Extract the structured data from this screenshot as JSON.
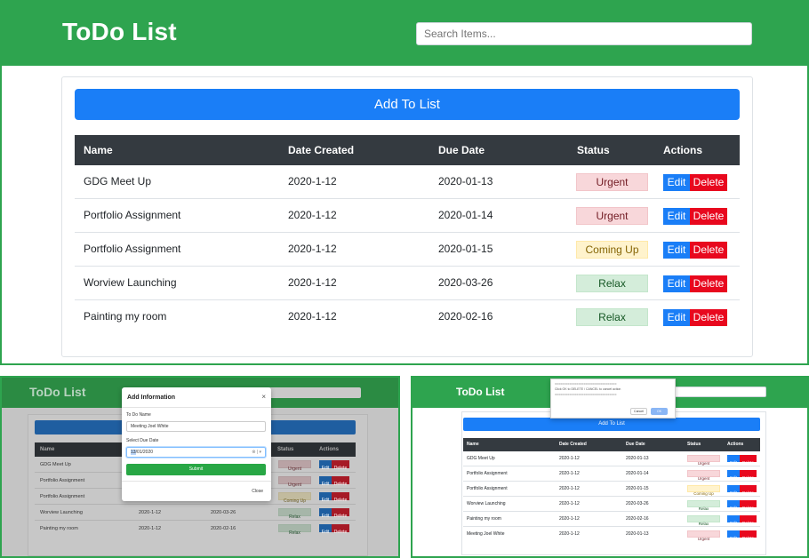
{
  "app": {
    "title": "ToDo List",
    "search_placeholder": "Search Items..."
  },
  "add_button_label": "Add To List",
  "columns": [
    "Name",
    "Date Created",
    "Due Date",
    "Status",
    "Actions"
  ],
  "actions": {
    "edit": "Edit",
    "delete": "Delete"
  },
  "rows": [
    {
      "name": "GDG Meet Up",
      "created": "2020-1-12",
      "due": "2020-01-13",
      "status": "Urgent"
    },
    {
      "name": "Portfolio Assignment",
      "created": "2020-1-12",
      "due": "2020-01-14",
      "status": "Urgent"
    },
    {
      "name": "Portfolio Assignment",
      "created": "2020-1-12",
      "due": "2020-01-15",
      "status": "Coming Up"
    },
    {
      "name": "Worview Launching",
      "created": "2020-1-12",
      "due": "2020-03-26",
      "status": "Relax"
    },
    {
      "name": "Painting my room",
      "created": "2020-1-12",
      "due": "2020-02-16",
      "status": "Relax"
    }
  ],
  "extra_row": {
    "name": "Meeting Joel White",
    "created": "2020-1-12",
    "due": "2020-01-13",
    "status": "Urgent"
  },
  "modal": {
    "title": "Add Information",
    "close_x": "×",
    "todo_label": "To Do Name",
    "todo_value": "Meeting Joel White",
    "due_label": "Select Due Date",
    "due_day": "13",
    "due_rest": "/01/2020",
    "submit": "Submit",
    "close": "Close"
  },
  "confirm_dialog": {
    "line1": "==================================",
    "line2": "Click OK to DELETE  /  CANCEL to cancel action",
    "line3": "==================================",
    "cancel": "Cancel",
    "ok": "OK"
  },
  "colors": {
    "header": "#2ea44f",
    "primary": "#1a7ef7",
    "danger": "#e8081e",
    "table_head": "#343a40"
  }
}
